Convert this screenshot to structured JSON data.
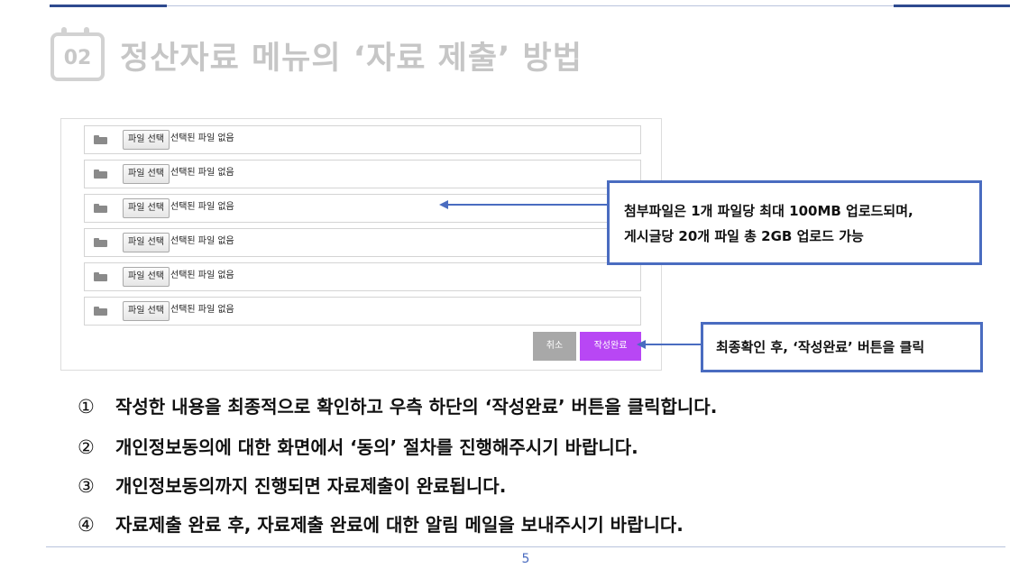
{
  "slide": {
    "number_badge": "02",
    "title": "정산자료 메뉴의 ‘자료 제출’ 방법",
    "page_number": "5"
  },
  "form": {
    "rows": [
      {
        "button": "파일 선택",
        "status": "선택된 파일 없음"
      },
      {
        "button": "파일 선택",
        "status": "선택된 파일 없음"
      },
      {
        "button": "파일 선택",
        "status": "선택된 파일 없음"
      },
      {
        "button": "파일 선택",
        "status": "선택된 파일 없음"
      },
      {
        "button": "파일 선택",
        "status": "선택된 파일 없음"
      },
      {
        "button": "파일 선택",
        "status": "선택된 파일 없음"
      }
    ],
    "cancel_label": "취소",
    "submit_label": "작성완료",
    "submit_color": "#b847f4",
    "cancel_color": "#a8a8a8"
  },
  "callouts": {
    "attachment_line1": "첨부파일은 1개 파일당 최대 100MB 업로드되며,",
    "attachment_line2": "게시글당 20개 파일 총 2GB 업로드 가능",
    "submit_hint": "최종확인 후, ‘작성완료’ 버튼을 클릭",
    "border_color": "#4a6cc0"
  },
  "steps": [
    {
      "marker": "①",
      "text": "작성한 내용을 최종적으로 확인하고 우측 하단의 ‘작성완료’ 버튼을 클릭합니다."
    },
    {
      "marker": "②",
      "text": "개인정보동의에 대한 화면에서 ‘동의’ 절차를 진행해주시기 바랍니다."
    },
    {
      "marker": "③",
      "text": "개인정보동의까지 진행되면 자료제출이 완료됩니다."
    },
    {
      "marker": "④",
      "text": "자료제출 완료 후, 자료제출 완료에 대한 알림 메일을 보내주시기 바랍니다."
    }
  ],
  "icons": {
    "calendar": "calendar-icon",
    "folder": "folder-icon",
    "arrow": "arrow-left-icon"
  }
}
